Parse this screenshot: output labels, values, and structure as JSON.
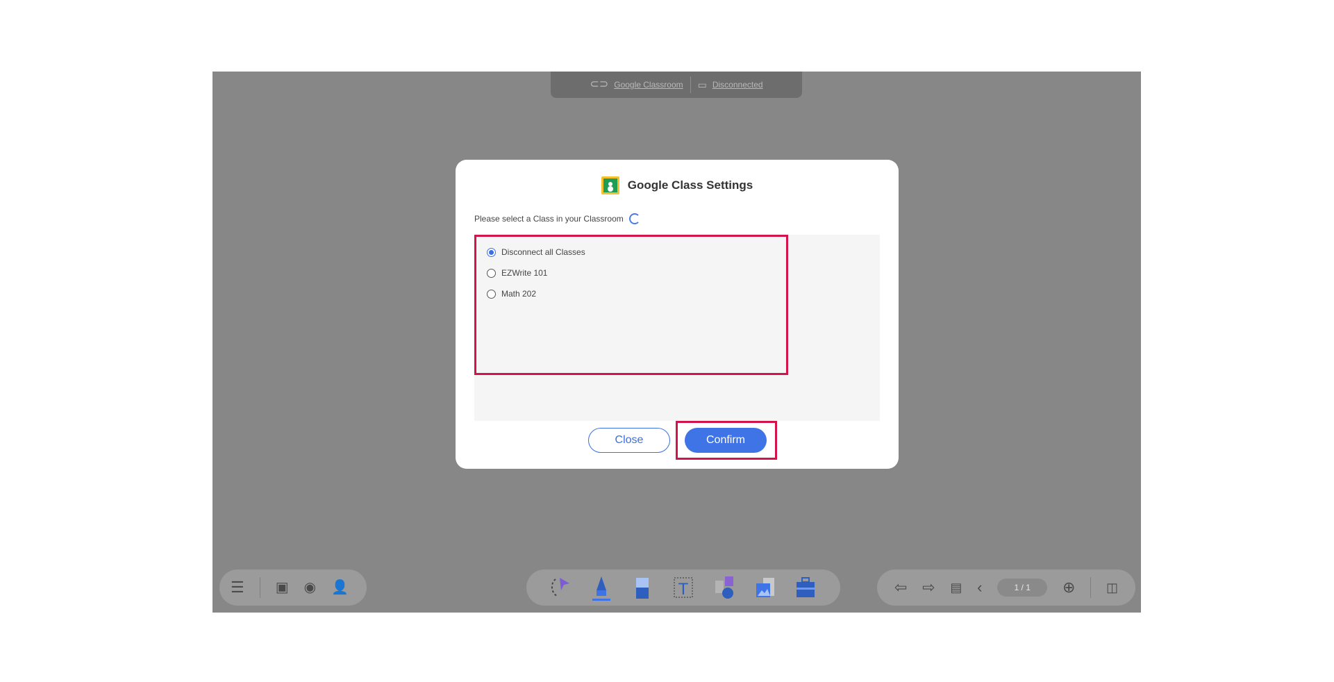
{
  "topbar": {
    "classroom_label": "Google Classroom",
    "status_label": "Disconnected"
  },
  "dialog": {
    "title": "Google Class Settings",
    "prompt": "Please select a Class in your Classroom",
    "options": [
      {
        "label": "Disconnect all Classes",
        "selected": true
      },
      {
        "label": "EZWrite 101",
        "selected": false
      },
      {
        "label": "Math 202",
        "selected": false
      }
    ],
    "close_label": "Close",
    "confirm_label": "Confirm"
  },
  "toolbar_left": {
    "icons": [
      "menu-icon",
      "save-icon",
      "record-icon",
      "add-user-icon"
    ]
  },
  "toolbar_mid": {
    "tools": [
      "lasso-select-icon",
      "pen-icon",
      "eraser-icon",
      "text-icon",
      "shapes-icon",
      "image-icon",
      "toolbox-icon"
    ]
  },
  "toolbar_right": {
    "page_indicator": "1 / 1"
  },
  "colors": {
    "accent": "#3f74e6",
    "highlight": "#d4134a",
    "overlay": "#878787"
  }
}
